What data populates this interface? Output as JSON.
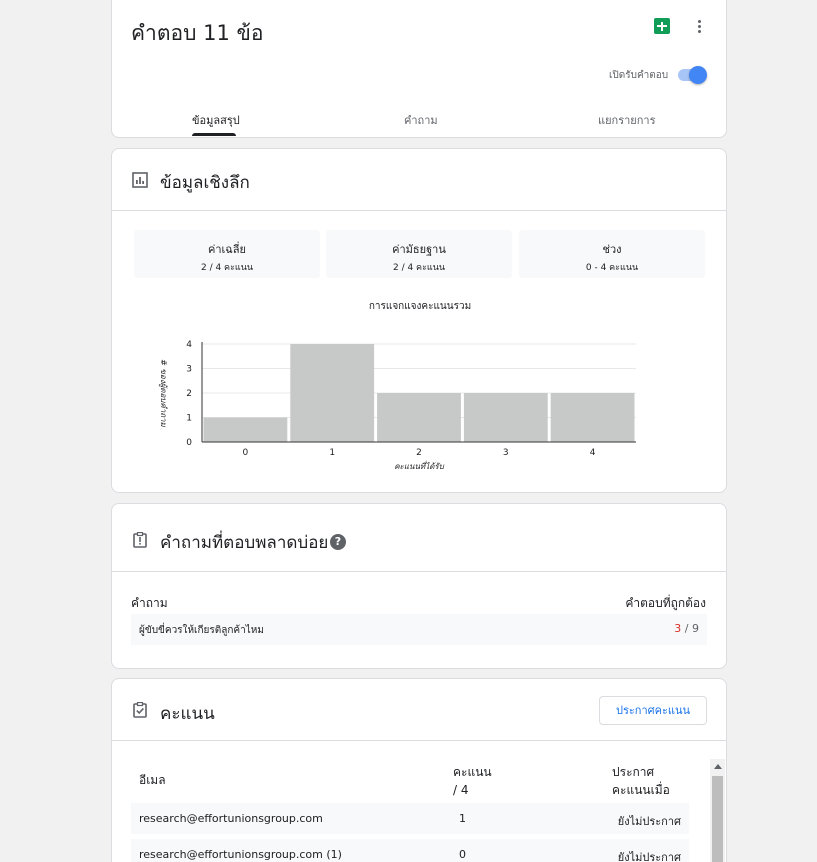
{
  "header": {
    "title": "คำตอบ 11 ข้อ",
    "accepting_label": "เปิดรับคำตอบ",
    "accepting": true,
    "sheets_icon": "google-sheets-icon",
    "more_icon": "more-vert-icon"
  },
  "tabs": [
    {
      "label": "ข้อมูลสรุป",
      "active": true
    },
    {
      "label": "คำถาม",
      "active": false
    },
    {
      "label": "แยกรายการ",
      "active": false
    }
  ],
  "insights": {
    "title": "ข้อมูลเชิงลึก",
    "icon": "bar-chart-icon",
    "stats": [
      {
        "label": "ค่าเฉลี่ย",
        "value": "2 / 4 คะแนน"
      },
      {
        "label": "ค่ามัธยฐาน",
        "value": "2 / 4 คะแนน"
      },
      {
        "label": "ช่วง",
        "value": "0 - 4 คะแนน"
      }
    ],
    "chart_title": "การแจกแจงคะแนนรวม"
  },
  "chart_data": {
    "type": "bar",
    "title": "การแจกแจงคะแนนรวม",
    "xlabel": "คะแนนที่ได้รับ",
    "ylabel": "# ของผู้ตอบคำถาม",
    "categories": [
      "0",
      "1",
      "2",
      "3",
      "4"
    ],
    "values": [
      1,
      4,
      2,
      2,
      2
    ],
    "ylim": [
      0,
      4
    ],
    "yticks": [
      "0",
      "1",
      "2",
      "3",
      "4"
    ],
    "grid": true,
    "bar_color": "#c7c8c8"
  },
  "missed": {
    "title": "คำถามที่ตอบพลาดบ่อย",
    "icon": "alert-clipboard-icon",
    "help_icon": "help-icon",
    "help_glyph": "?",
    "col_question": "คำถาม",
    "col_correct": "คำตอบที่ถูกต้อง",
    "rows": [
      {
        "question": "ผู้ขับขี่ควรให้เกียรติลูกค้าไหม",
        "correct": "3",
        "sep": " / ",
        "total": "9"
      }
    ]
  },
  "scores": {
    "title": "คะแนน",
    "icon": "assignment-check-icon",
    "release_button": "ประกาศคะแนน",
    "col_email": "อีเมล",
    "col_score_1": "คะแนน",
    "col_score_2": "/ 4",
    "col_released_1": "ประกาศ",
    "col_released_2": "คะแนนเมื่อ",
    "rows": [
      {
        "email": "research@effortunionsgroup.com",
        "score": "1",
        "status": "ยังไม่ประกาศ"
      },
      {
        "email": "research@effortunionsgroup.com (1)",
        "score": "0",
        "status": "ยังไม่ประกาศ"
      }
    ]
  }
}
